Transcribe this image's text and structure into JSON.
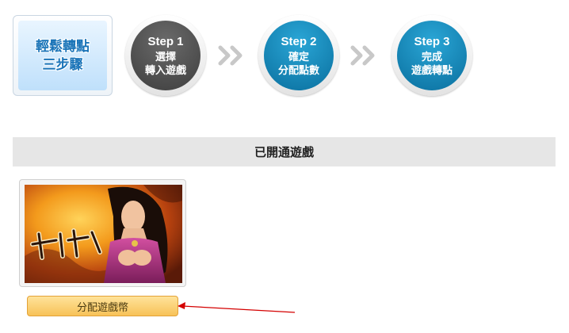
{
  "intro": {
    "line1": "輕鬆轉點",
    "line2": "三步驟"
  },
  "steps": [
    {
      "num": "Step 1",
      "line1": "選擇",
      "line2": "轉入遊戲"
    },
    {
      "num": "Step 2",
      "line1": "確定",
      "line2": "分配點數"
    },
    {
      "num": "Step 3",
      "line1": "完成",
      "line2": "遊戲轉點"
    }
  ],
  "section": {
    "title": "已開通遊戲"
  },
  "game": {
    "logo_text": "九戲中原",
    "button_label": "分配遊戲幣"
  },
  "colors": {
    "step_active": "#555555",
    "step_blue": "#1285b8",
    "button": "#f7c258",
    "arrow": "#d40000"
  }
}
